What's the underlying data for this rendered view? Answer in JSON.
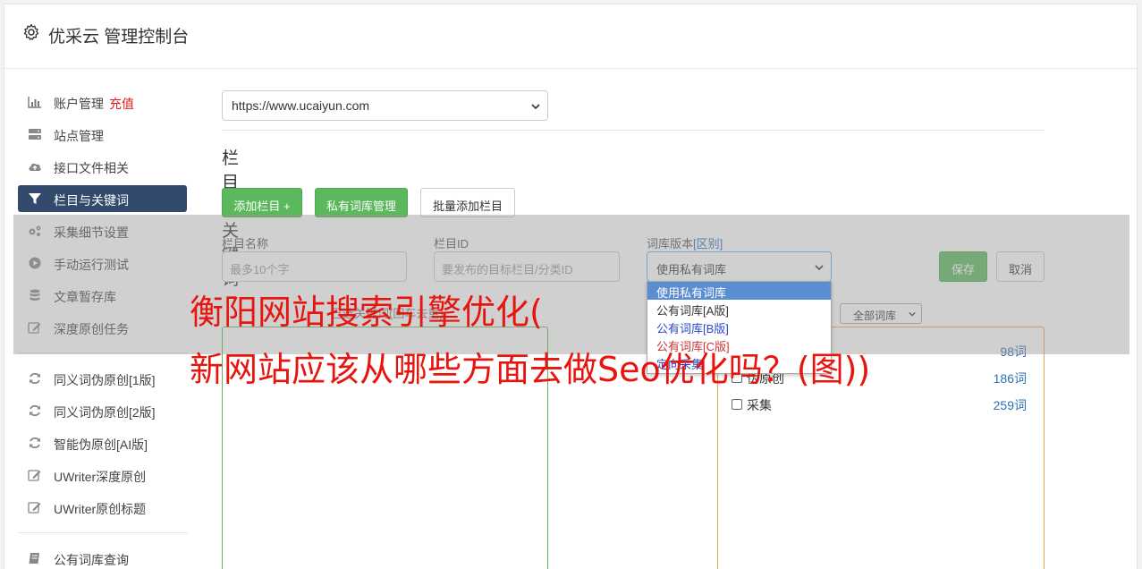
{
  "header": {
    "title": "优采云 管理控制台",
    "icon": "gear-icon"
  },
  "sidebar": {
    "items": [
      {
        "label": "账户管理",
        "extra": "充值",
        "icon": "bar-chart-icon"
      },
      {
        "label": "站点管理",
        "icon": "server-icon"
      },
      {
        "label": "接口文件相关",
        "icon": "cloud-upload-icon"
      },
      {
        "label": "栏目与关键词",
        "icon": "filter-icon",
        "active": true
      },
      {
        "label": "采集细节设置",
        "icon": "cogs-icon"
      },
      {
        "label": "手动运行测试",
        "icon": "play-circle-icon"
      },
      {
        "label": "文章暂存库",
        "icon": "database-icon"
      },
      {
        "label": "深度原创任务",
        "icon": "edit-icon"
      },
      {
        "label": "同义词伪原创[1版]",
        "icon": "refresh-icon"
      },
      {
        "label": "同义词伪原创[2版]",
        "icon": "refresh-icon"
      },
      {
        "label": "智能伪原创[AI版]",
        "icon": "refresh-icon"
      },
      {
        "label": "UWriter深度原创",
        "icon": "edit-icon"
      },
      {
        "label": "UWriter原创标题",
        "icon": "edit-icon"
      },
      {
        "label": "公有词库查询",
        "icon": "book-icon"
      }
    ]
  },
  "main": {
    "site_select": {
      "value": "https://www.ucaiyun.com"
    },
    "section_title": "栏目与关键词",
    "buttons": {
      "add_column": "添加栏目 +",
      "private_lib": "私有词库管理",
      "batch_add": "批量添加栏目"
    },
    "form": {
      "name_label": "栏目名称",
      "name_placeholder": "最多10个字",
      "id_label": "栏目ID",
      "id_placeholder": "要发布的目标栏目/分类ID",
      "lib_label": "词库版本",
      "lib_label_link": "[区别]",
      "lib_value": "使用私有词库",
      "save": "保存",
      "cancel": "取消"
    },
    "dropdown_options": [
      {
        "label": "使用私有词库",
        "style": "sel"
      },
      {
        "label": "公有词库[A版]",
        "style": ""
      },
      {
        "label": "公有词库[B版]",
        "style": "blue"
      },
      {
        "label": "公有词库[C版]",
        "style": "red"
      },
      {
        "label": "定向采集",
        "style": "blue"
      }
    ],
    "keyword_box_label": "已选关键词(回车去重)",
    "lib_filter": "全部词库",
    "libraries": [
      {
        "name": "",
        "count": "98词"
      },
      {
        "name": "伪原创",
        "count": "186词"
      },
      {
        "name": "采集",
        "count": "259词"
      }
    ]
  },
  "watermark": {
    "line1": "衡阳网站搜索引擎优化(",
    "line2": "新网站应该从哪些方面去做Seo优化吗？(图))"
  },
  "colors": {
    "accent_green": "#5cb85c",
    "nav_active": "#324a6b",
    "link_blue": "#2f6fb3",
    "watermark_red": "#e8150f"
  }
}
